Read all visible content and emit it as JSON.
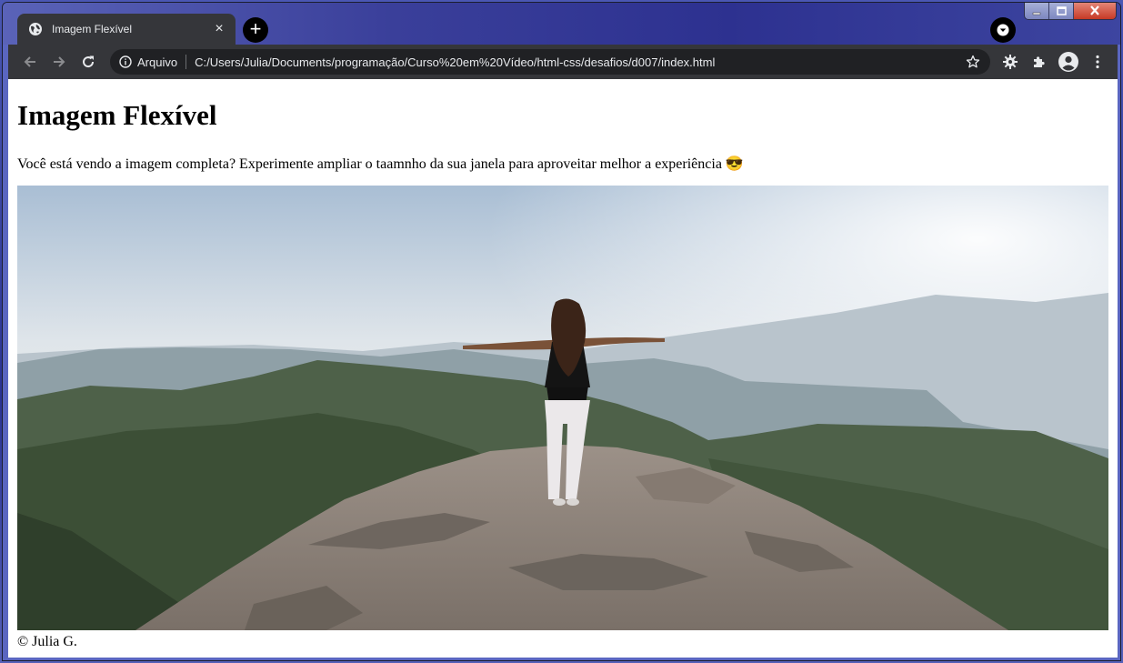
{
  "window": {
    "controls": [
      "minimize",
      "maximize",
      "close"
    ]
  },
  "tab": {
    "title": "Imagem Flexível",
    "icon": "globe-icon",
    "close_glyph": "×"
  },
  "newtab_glyph": "+",
  "toolbar": {
    "back_icon": "arrow-left-icon",
    "forward_icon": "arrow-right-icon",
    "reload_icon": "reload-icon",
    "security_label": "Arquivo",
    "url": "C:/Users/Julia/Documents/programação/Curso%20em%20Vídeo/html-css/desafios/d007/index.html"
  },
  "page": {
    "heading": "Imagem Flexível",
    "lead": "Você está vendo a imagem completa? Experimente ampliar o taamnho da sua janela para aproveitar melhor a experiência 😎",
    "footer": "© Julia G."
  }
}
